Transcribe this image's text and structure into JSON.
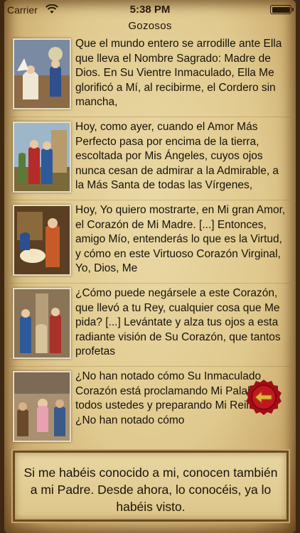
{
  "status_bar": {
    "carrier": "Carrier",
    "time": "5:38 PM"
  },
  "nav": {
    "title": "Gozosos"
  },
  "rows": [
    {
      "text": "Que el mundo entero se arrodille ante Ella que lleva el Nombre Sagrado: Madre de Dios. En Su Vientre Inmaculado, Ella Me glorificó a Mí, al recibirme, el Cordero sin mancha,"
    },
    {
      "text": "Hoy, como ayer, cuando el Amor Más Perfecto pasa por encima de la tierra, escoltada por Mis Ángeles, cuyos ojos nunca cesan de admirar a la Admirable, a la Más Santa de todas las Vírgenes,"
    },
    {
      "text": "Hoy, Yo quiero mostrarte, en Mi gran Amor, el Corazón de Mi Madre. [...] Entonces, amigo Mío, entenderás lo que es la Virtud, y cómo en este Virtuoso Corazón Virginal, Yo, Dios, Me"
    },
    {
      "text": "¿Cómo puede negársele a este Corazón, que llevó a tu Rey, cualquier cosa que Me pida? [...] Levántate y alza tus ojos a esta radiante visión de Su Corazón, que tantos profetas"
    },
    {
      "text": "¿No han notado cómo Su Inmaculado Corazón está proclamando Mi Palabra a todos ustedes y preparando Mi Reino? ¿No han notado cómo"
    }
  ],
  "quote": {
    "text": "Si me habéis conocido a mi, conocen también a mi Padre. Desde ahora, lo conocéis, ya lo habéis visto."
  },
  "icons": {
    "wifi": "wifi-icon",
    "battery": "battery-icon",
    "seal": "back-arrow-icon"
  },
  "colors": {
    "parchment": "#e0c98e",
    "seal_red": "#b0121b",
    "seal_arrow": "#e3b43a"
  }
}
